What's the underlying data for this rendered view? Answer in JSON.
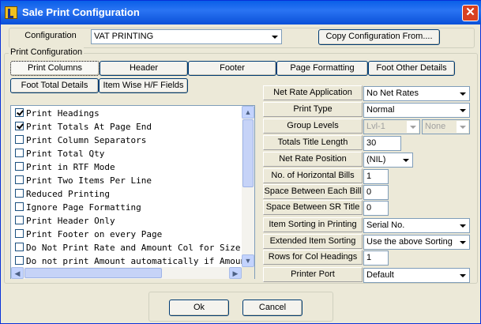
{
  "window": {
    "title": "Sale Print Configuration",
    "close": "✕"
  },
  "configuration": {
    "label": "Configuration",
    "value": "VAT PRINTING",
    "copy_button": "Copy Configuration From...."
  },
  "group_label": "Print Configuration",
  "tabs": {
    "print_columns": "Print Columns",
    "header": "Header",
    "footer": "Footer",
    "page_formatting": "Page Formatting",
    "foot_other_details": "Foot Other Details",
    "foot_total_details": "Foot Total Details",
    "item_wise": "Item Wise H/F Fields"
  },
  "options": [
    {
      "label": "Print Headings",
      "checked": true
    },
    {
      "label": "Print Totals At Page End",
      "checked": true
    },
    {
      "label": "Print Column Separators",
      "checked": false
    },
    {
      "label": "Print Total Qty",
      "checked": false
    },
    {
      "label": "Print in RTF Mode",
      "checked": false
    },
    {
      "label": "Print Two Items Per Line",
      "checked": false
    },
    {
      "label": "Reduced Printing",
      "checked": false
    },
    {
      "label": "Ignore Page Formatting",
      "checked": false
    },
    {
      "label": "Print Header Only",
      "checked": false
    },
    {
      "label": "Print Footer on every Page",
      "checked": false
    },
    {
      "label": "Do Not Print Rate and Amount Col for Size Print",
      "checked": false
    },
    {
      "label": "Do not print Amount automatically if Amount Col",
      "checked": false
    }
  ],
  "settings": {
    "net_rate_application": {
      "label": "Net Rate Application",
      "value": "No Net Rates"
    },
    "print_type": {
      "label": "Print Type",
      "value": "Normal"
    },
    "group_levels": {
      "label": "Group Levels",
      "value1": "Lvl-1",
      "value2": "None"
    },
    "totals_title_length": {
      "label": "Totals Title Length",
      "value": "30"
    },
    "net_rate_position": {
      "label": "Net Rate Position",
      "value": "(NIL)"
    },
    "horizontal_bills": {
      "label": "No. of Horizontal Bills",
      "value": "1"
    },
    "space_each_bill": {
      "label": "Space Between Each Bill",
      "value": "0"
    },
    "space_sr_title": {
      "label": "Space Between SR Title",
      "value": "0"
    },
    "item_sorting": {
      "label": "Item Sorting in Printing",
      "value": "Serial No."
    },
    "extended_sorting": {
      "label": "Extended Item Sorting",
      "value": "Use the above Sorting"
    },
    "rows_col_headings": {
      "label": "Rows for Col Headings",
      "value": "1"
    },
    "printer_port": {
      "label": "Printer Port",
      "value": "Default"
    }
  },
  "buttons": {
    "ok": "Ok",
    "cancel": "Cancel"
  }
}
